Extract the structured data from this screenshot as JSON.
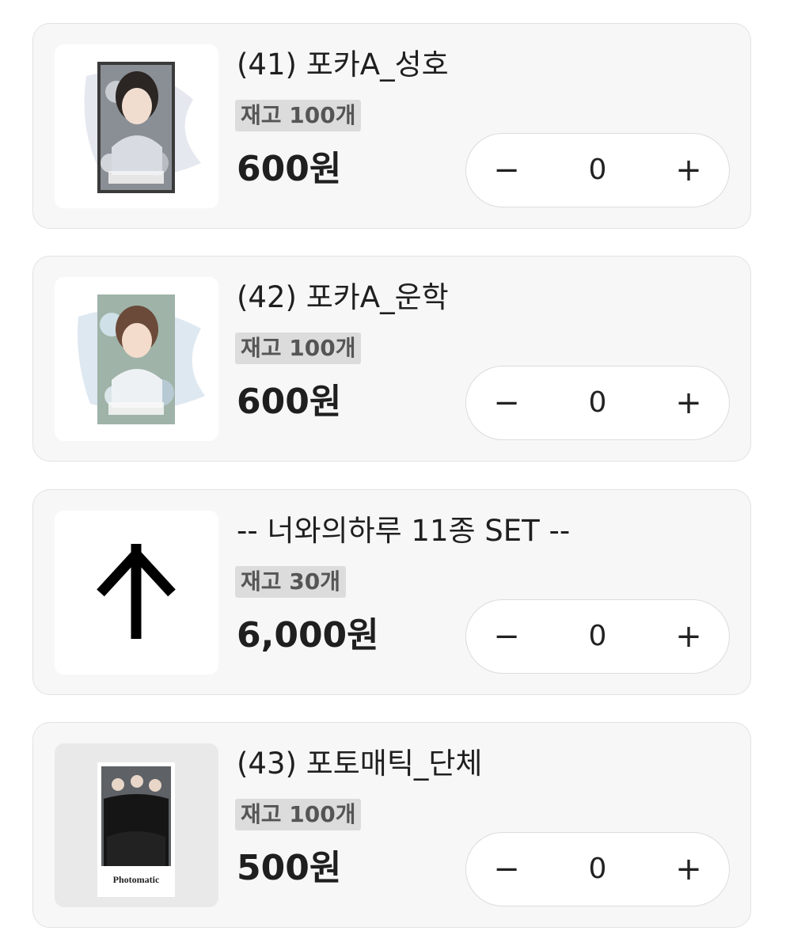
{
  "products": [
    {
      "title": "(41) 포카A_성호",
      "stock": "재고 100개",
      "price": "600원",
      "quantity": "0",
      "minus_icon": "minus-icon",
      "plus_icon": "plus-icon",
      "thumbnail": "photocard-seongho-image"
    },
    {
      "title": "(42) 포카A_운학",
      "stock": "재고 100개",
      "price": "600원",
      "quantity": "0",
      "minus_icon": "minus-icon",
      "plus_icon": "plus-icon",
      "thumbnail": "photocard-woonhak-image"
    },
    {
      "title": "-- 너와의하루 11종 SET --",
      "stock": "재고 30개",
      "price": "6,000원",
      "quantity": "0",
      "minus_icon": "minus-icon",
      "plus_icon": "plus-icon",
      "thumbnail": "arrow-up-icon"
    },
    {
      "title": "(43) 포토매틱_단체",
      "stock": "재고 100개",
      "price": "500원",
      "quantity": "0",
      "minus_icon": "minus-icon",
      "plus_icon": "plus-icon",
      "thumbnail": "photomatic-group-image",
      "thumbnail_text": "Photomatic"
    }
  ],
  "symbols": {
    "minus": "−",
    "plus": "+"
  },
  "colors": {
    "card_background": "#f7f7f7",
    "card_border": "#e2e2e2",
    "stock_badge_background": "#dcdcdc",
    "stock_badge_text": "#555555",
    "text": "#1f1f1f"
  }
}
